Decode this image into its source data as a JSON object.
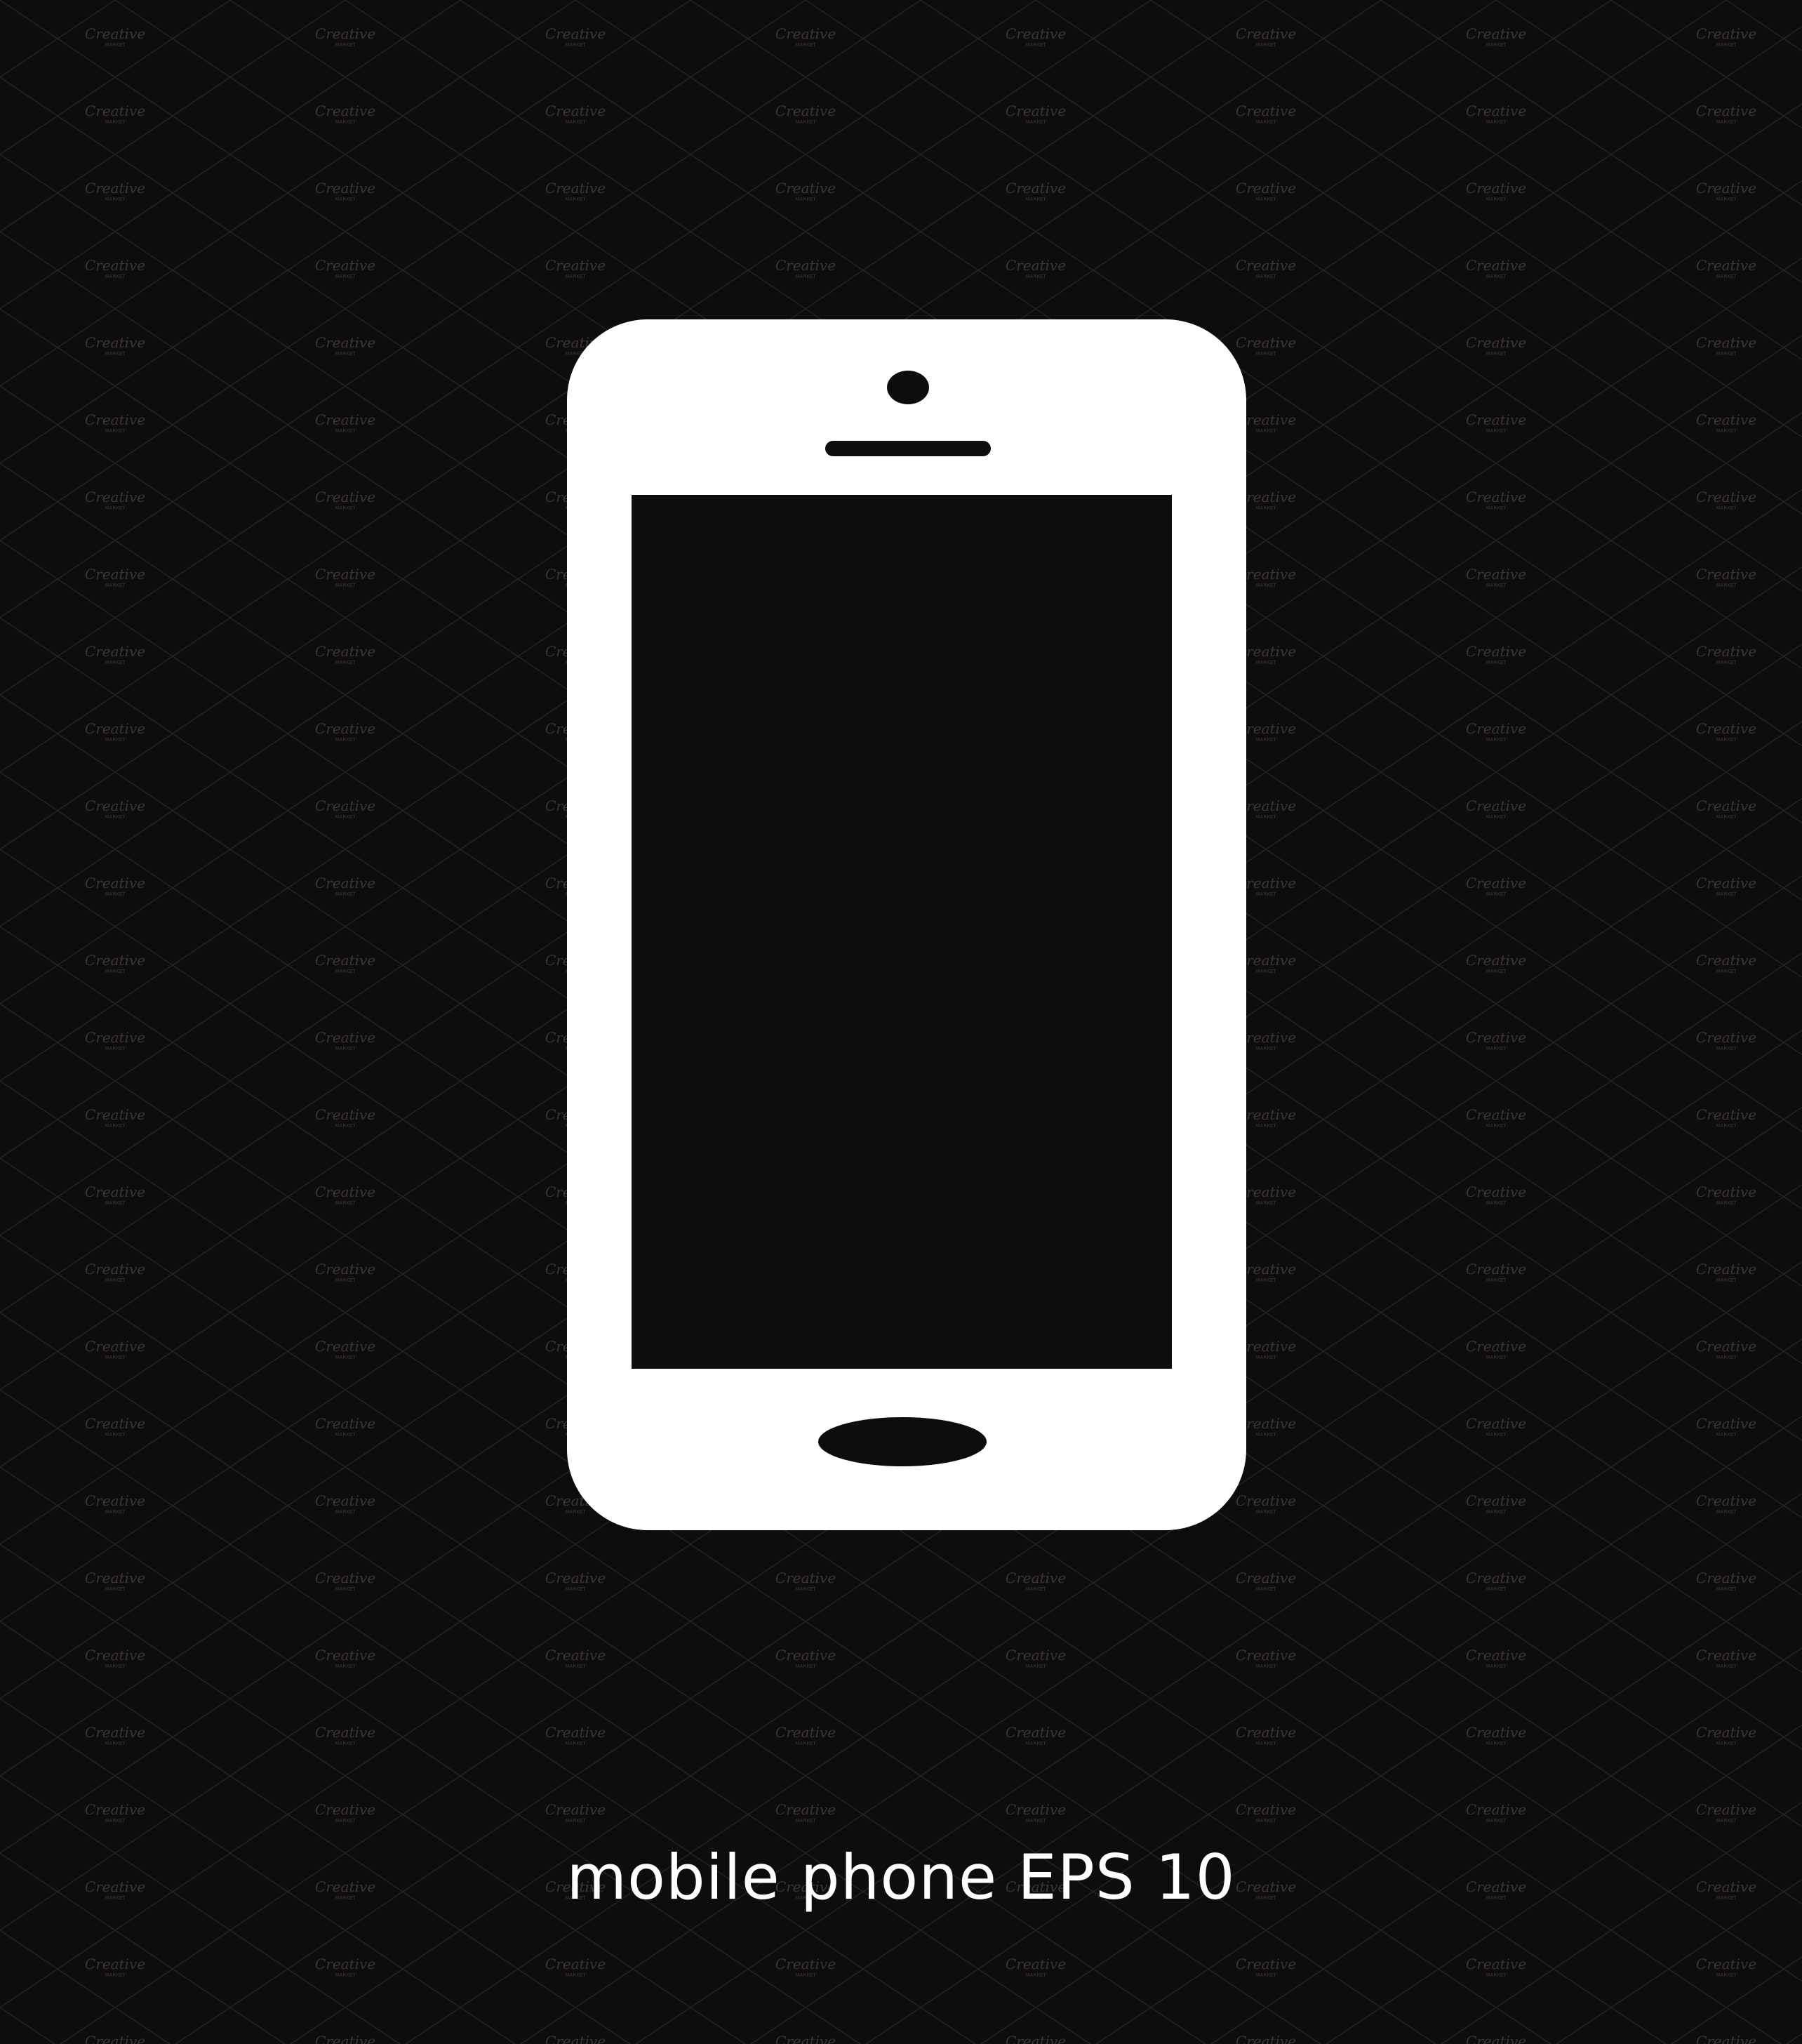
{
  "background_color": "#0f0c0c",
  "phone_color": "#ffffff",
  "screen_color": "#0f0c0c",
  "illustration": {
    "icon": "mobile-phone-icon",
    "parts": [
      "camera-icon",
      "speaker-grille",
      "screen",
      "home-button"
    ]
  },
  "caption": "mobile phone EPS 10",
  "watermark": {
    "text": "Creative",
    "subtext": "MARKET"
  }
}
